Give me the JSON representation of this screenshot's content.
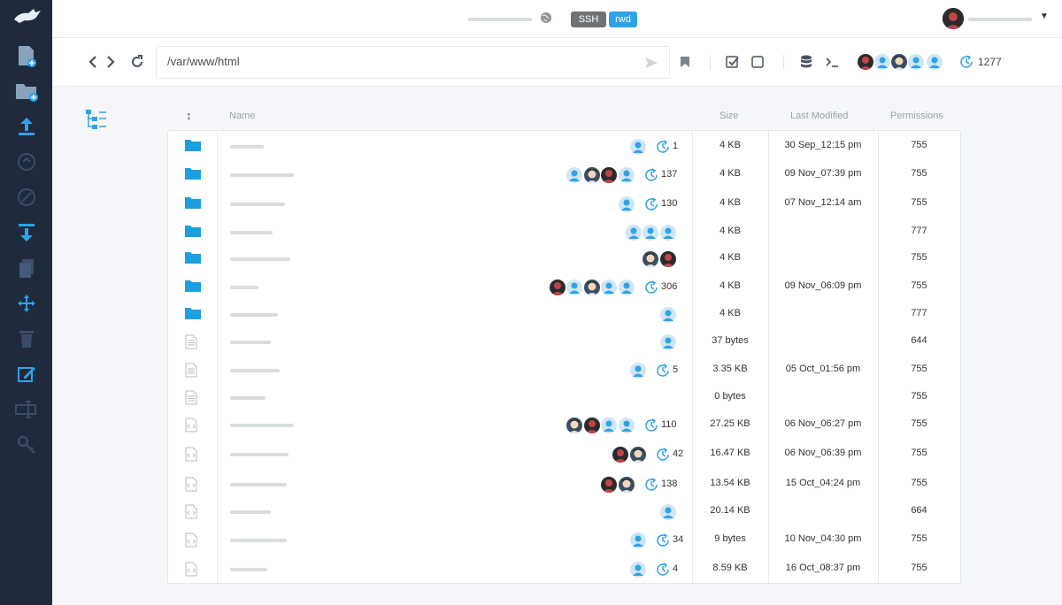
{
  "header": {
    "badges": {
      "ssh": "SSH",
      "rwd": "rwd"
    }
  },
  "toolbar": {
    "path": "/var/www/html",
    "history_count": "1277"
  },
  "table": {
    "columns": {
      "name": "Name",
      "size": "Size",
      "modified": "Last Modified",
      "permissions": "Permissions"
    },
    "rows": [
      {
        "type": "folder",
        "size": "4 KB",
        "modified": "30 Sep_12:15 pm",
        "permissions": "755",
        "history": "1",
        "users": [
          "generic"
        ]
      },
      {
        "type": "folder",
        "size": "4 KB",
        "modified": "09 Nov_07:39 pm",
        "permissions": "755",
        "history": "137",
        "users": [
          "generic",
          "photo-b",
          "photo-a",
          "generic"
        ]
      },
      {
        "type": "folder",
        "size": "4 KB",
        "modified": "07 Nov_12:14 am",
        "permissions": "755",
        "history": "130",
        "users": [
          "generic"
        ]
      },
      {
        "type": "folder",
        "size": "4 KB",
        "modified": "",
        "permissions": "777",
        "history": "",
        "users": [
          "generic",
          "generic",
          "generic"
        ]
      },
      {
        "type": "folder",
        "size": "4 KB",
        "modified": "",
        "permissions": "755",
        "history": "",
        "users": [
          "photo-b",
          "photo-a"
        ]
      },
      {
        "type": "folder",
        "size": "4 KB",
        "modified": "09 Nov_06:09 pm",
        "permissions": "755",
        "history": "306",
        "users": [
          "photo-a",
          "generic",
          "photo-b",
          "generic",
          "generic"
        ]
      },
      {
        "type": "folder",
        "size": "4 KB",
        "modified": "",
        "permissions": "777",
        "history": "",
        "users": [
          "generic"
        ]
      },
      {
        "type": "text",
        "size": "37 bytes",
        "modified": "",
        "permissions": "644",
        "history": "",
        "users": [
          "generic"
        ]
      },
      {
        "type": "text",
        "size": "3.35 KB",
        "modified": "05 Oct_01:56 pm",
        "permissions": "755",
        "history": "5",
        "users": [
          "generic"
        ]
      },
      {
        "type": "text",
        "size": "0 bytes",
        "modified": "",
        "permissions": "755",
        "history": "",
        "users": []
      },
      {
        "type": "code",
        "size": "27.25 KB",
        "modified": "06 Nov_06:27 pm",
        "permissions": "755",
        "history": "110",
        "users": [
          "photo-b",
          "photo-a",
          "generic",
          "generic"
        ]
      },
      {
        "type": "code",
        "size": "16.47 KB",
        "modified": "06 Nov_06:39 pm",
        "permissions": "755",
        "history": "42",
        "users": [
          "photo-a",
          "photo-b"
        ]
      },
      {
        "type": "code",
        "size": "13.54 KB",
        "modified": "15 Oct_04:24 pm",
        "permissions": "755",
        "history": "138",
        "users": [
          "photo-a",
          "photo-b"
        ]
      },
      {
        "type": "code",
        "size": "20.14 KB",
        "modified": "",
        "permissions": "664",
        "history": "",
        "users": [
          "generic"
        ]
      },
      {
        "type": "code",
        "size": "9 bytes",
        "modified": "10 Nov_04:30 pm",
        "permissions": "755",
        "history": "34",
        "users": [
          "generic"
        ]
      },
      {
        "type": "code",
        "size": "8.59 KB",
        "modified": "16 Oct_08:37 pm",
        "permissions": "755",
        "history": "4",
        "users": [
          "generic"
        ]
      }
    ]
  },
  "colors": {
    "sidebar": "#1f2a3c",
    "accent": "#2ea3e6",
    "folder": "#1aa0e0",
    "avatar_generic": "#cfe6f5"
  },
  "icons": {
    "sidebar": [
      "new-file-icon",
      "new-folder-icon",
      "upload-icon",
      "sync-icon",
      "link-icon",
      "download-icon",
      "copy-icon",
      "move-icon",
      "delete-icon",
      "edit-icon",
      "rename-icon",
      "key-icon"
    ]
  }
}
